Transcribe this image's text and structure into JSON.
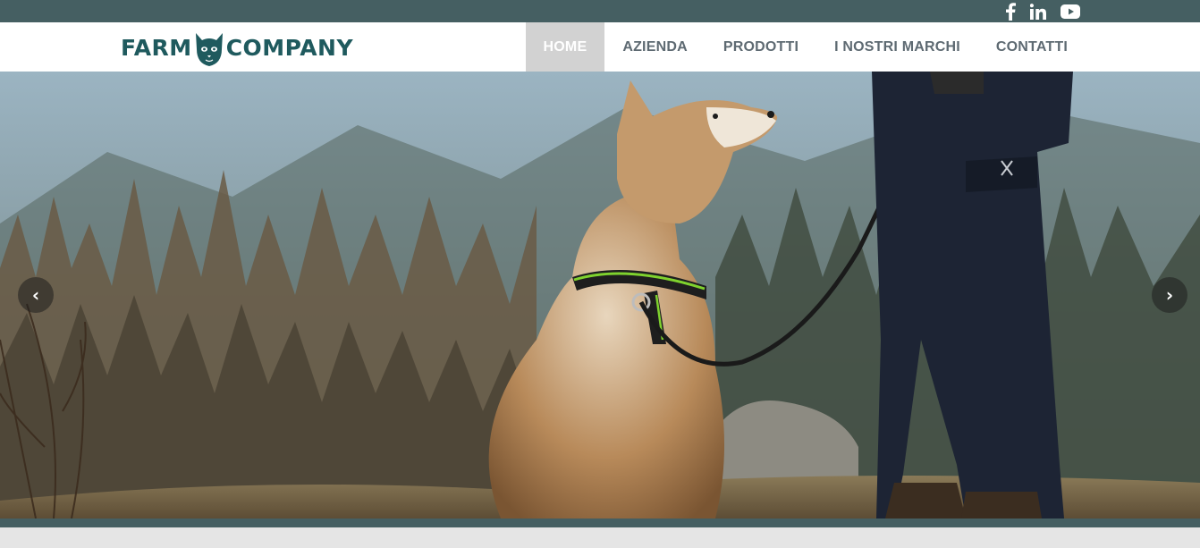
{
  "social": {
    "facebook_icon": "facebook-icon",
    "linkedin_icon": "linkedin-icon",
    "youtube_icon": "youtube-icon"
  },
  "brand": {
    "left": "FARM",
    "right": "COMPANY",
    "mascot_icon": "cat-mascot-icon"
  },
  "nav": {
    "home": "HOME",
    "azienda": "AZIENDA",
    "prodotti": "PRODOTTI",
    "marchi": "I NOSTRI MARCHI",
    "contatti": "CONTATTI"
  },
  "slider": {
    "prev_glyph": "‹",
    "next_glyph": "›",
    "prev_icon": "chevron-left-icon",
    "next_icon": "chevron-right-icon"
  },
  "colors": {
    "topbar": "#455f62",
    "nav_active_bg": "#d2d2d2",
    "nav_text": "#5e6a72",
    "brand": "#1f5a5e"
  }
}
